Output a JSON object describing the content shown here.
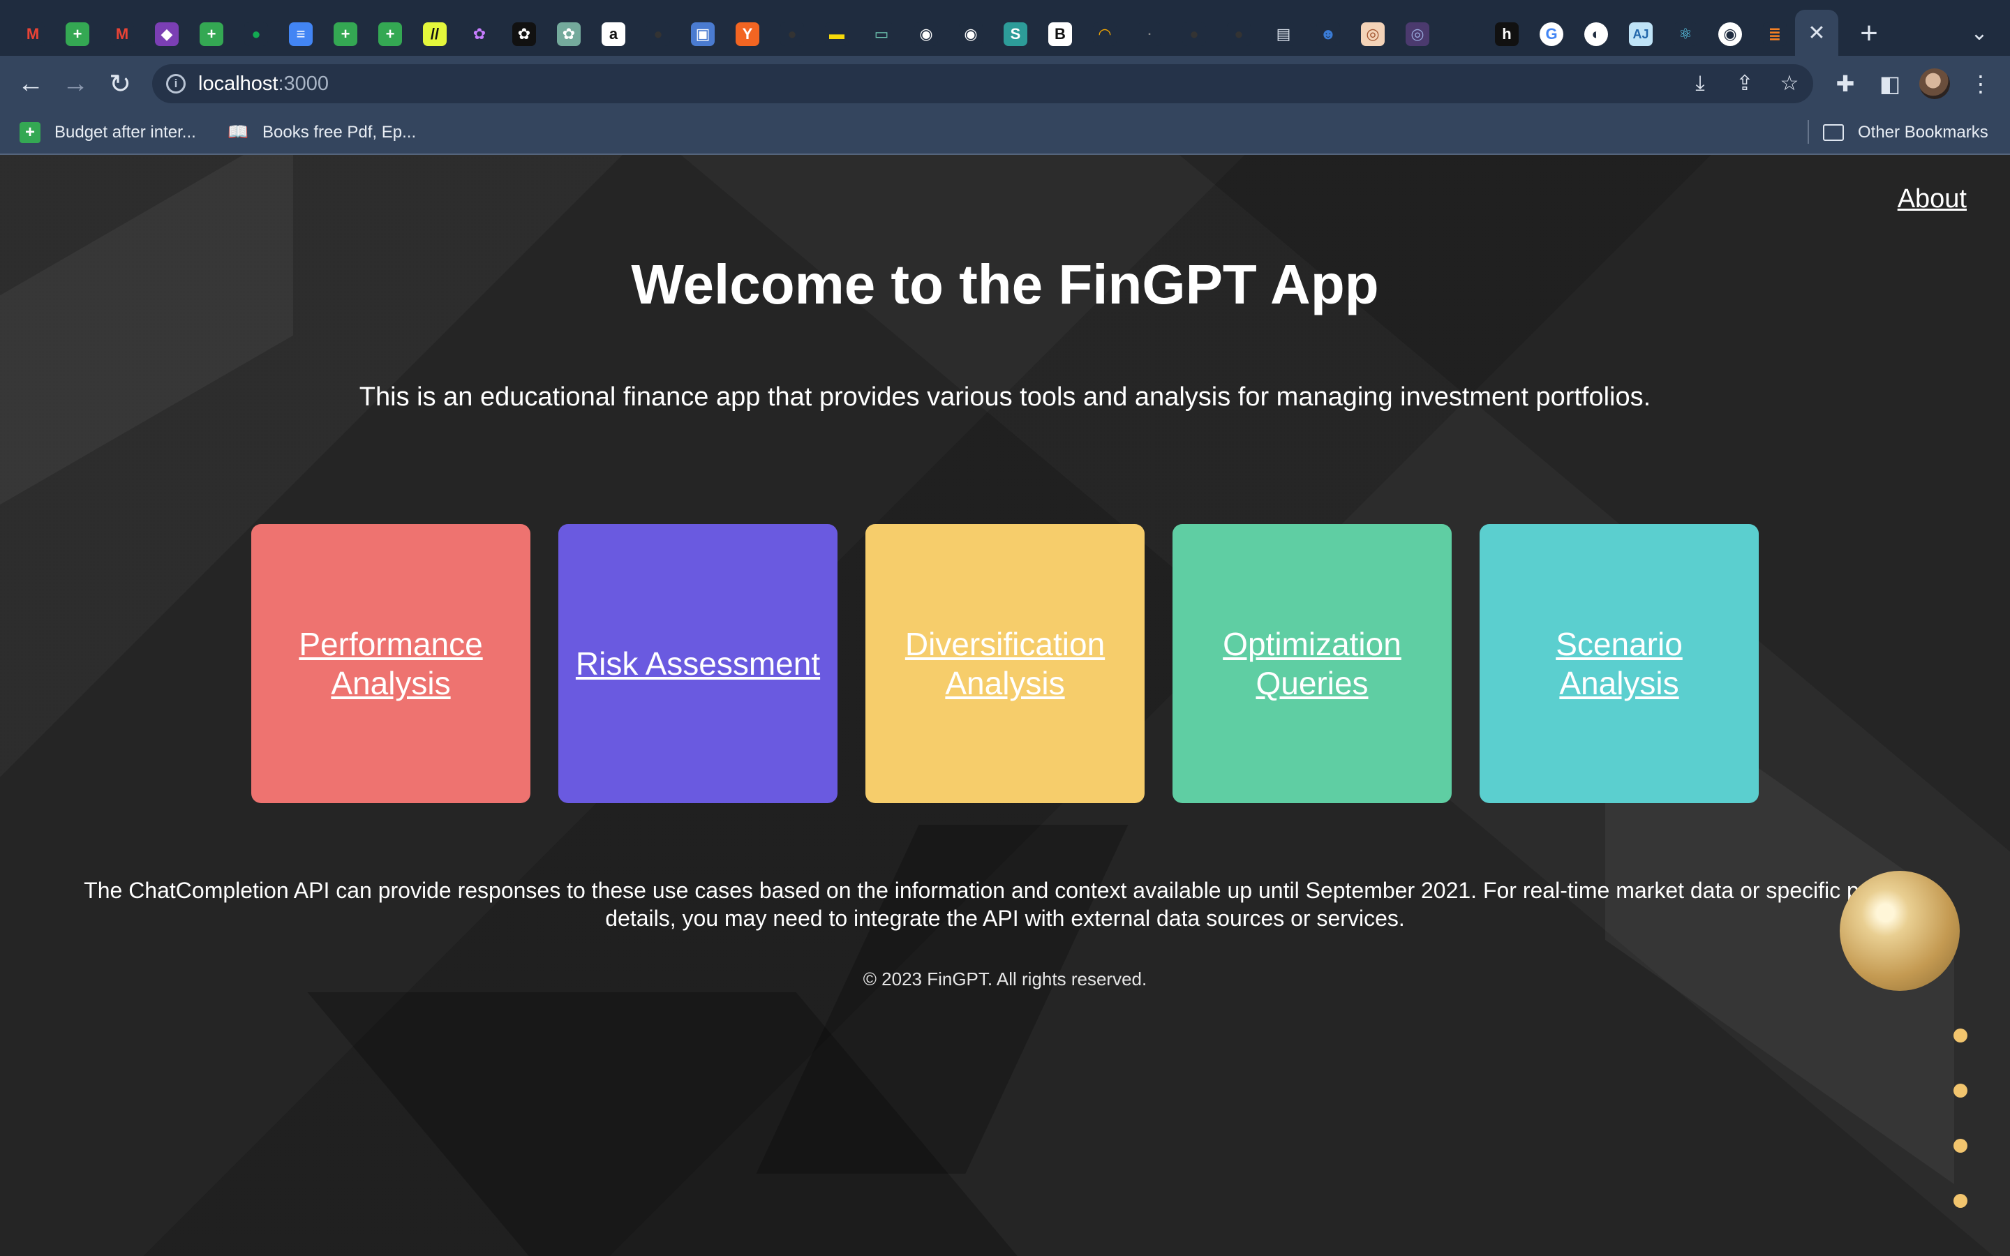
{
  "browser": {
    "url_host": "localhost",
    "url_port": ":3000",
    "tab_icons": [
      "gmail-icon",
      "sheets-icon",
      "gmail-icon",
      "purple-icon",
      "sheets-icon",
      "mongodb-icon",
      "docs-icon",
      "sheets-icon",
      "sheets-icon",
      "hackmd-icon",
      "openai-icon",
      "openai-icon",
      "openai-icon",
      "amazon-icon",
      "github-icon",
      "pdf-icon",
      "ycombinator-icon",
      "github-icon",
      "tag-icon",
      "dash-icon",
      "record-icon",
      "record-icon",
      "s-icon",
      "b-icon",
      "audible-icon",
      "logo-icon",
      "github-icon",
      "github-icon",
      "card-icon",
      "reddit-icon",
      "shell-icon",
      "circle-icon",
      "blank-icon",
      "h-icon",
      "google-icon",
      "globe-icon",
      "aj-icon",
      "react-icon",
      "chrome-icon",
      "stackoverflow-icon"
    ],
    "tab_close_glyph": "✕",
    "new_tab_glyph": "+",
    "tab_menu_glyph": "⌄",
    "bookmarks": [
      {
        "label": "Budget after inter...",
        "icon": "sheets-icon"
      },
      {
        "label": "Books free Pdf, Ep...",
        "icon": "book-icon"
      }
    ],
    "other_bookmarks": "Other Bookmarks"
  },
  "page": {
    "about": "About",
    "title": "Welcome to the FinGPT App",
    "subtitle": "This is an educational finance app that provides various tools and analysis for managing investment portfolios.",
    "cards": [
      {
        "label": "Performance Analysis",
        "color": "#ee7370"
      },
      {
        "label": "Risk Assessment",
        "color": "#6a5ae0"
      },
      {
        "label": "Diversification Analysis",
        "color": "#f6cd6b"
      },
      {
        "label": "Optimization Queries",
        "color": "#5fcea3"
      },
      {
        "label": "Scenario Analysis",
        "color": "#5bcfcf"
      }
    ],
    "api_note": "The ChatCompletion API can provide responses to these use cases based on the information and context available up until September 2021. For real-time market data or specific portfolio details, you may need to integrate the API with external data sources or services.",
    "footer": "© 2023 FinGPT. All rights reserved."
  }
}
